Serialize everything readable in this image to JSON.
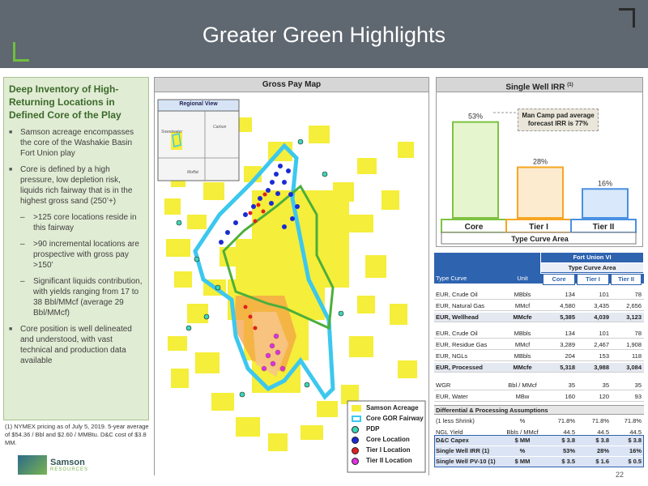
{
  "title": "Greater Green Highlights",
  "left_panel": {
    "heading": "Deep Inventory of High-Returning Locations in Defined Core of the Play",
    "bullets": [
      "Samson acreage encompasses the core of the Washakie Basin Fort Union play",
      "Core is defined by a high pressure, low depletion risk, liquids rich fairway that is in the highest gross sand (250’+)"
    ],
    "sub_bullets": [
      ">125 core locations reside in this fairway",
      ">90 incremental locations are prospective with gross pay >150’",
      "Significant liquids contribution, with yields ranging from 17 to 38 Bbl/MMcf (average 29 Bbl/MMcf)"
    ],
    "last_bullet": "Core position is well delineated and understood, with vast technical and production data available"
  },
  "footnote": "(1)  NYMEX pricing as of July 5, 2019. 5-year average of $54.36 / Bbl and $2.60 / MMBtu. D&C cost of $3.8 MM.",
  "logo": {
    "name": "Samson",
    "sub": "RESOURCES"
  },
  "map": {
    "title": "Gross Pay Map",
    "inset_title": "Regional View",
    "inset_labels": [
      "Sweetwater",
      "Carbon",
      "Moffat"
    ],
    "legend": [
      {
        "label": "Samson Acreage",
        "color": "#f5ee3a",
        "kind": "rect"
      },
      {
        "label": "Core GOR Fairway",
        "color": "#3cc8ee",
        "kind": "outline"
      },
      {
        "label": "PDP",
        "color": "#3ad6b6",
        "kind": "dot"
      },
      {
        "label": "Core Location",
        "color": "#1a2bd1",
        "kind": "dot"
      },
      {
        "label": "Tier I Location",
        "color": "#e02020",
        "kind": "dot"
      },
      {
        "label": "Tier II Location",
        "color": "#e030e0",
        "kind": "dot"
      }
    ]
  },
  "irr": {
    "title": "Single Well IRR",
    "title_sup": "(1)",
    "callout": "Man Camp pad average forecast IRR is 77%",
    "axis_label": "Type Curve Area"
  },
  "chart_data": {
    "type": "bar",
    "title": "Single Well IRR",
    "categories": [
      "Core",
      "Tier I",
      "Tier II"
    ],
    "values": [
      53,
      28,
      16
    ],
    "value_labels": [
      "53%",
      "28%",
      "16%"
    ],
    "xlabel": "Type Curve Area",
    "ylim": [
      0,
      60
    ],
    "colors": {
      "fill": [
        "#e5f5ce",
        "#fdebcf",
        "#d9e8fa"
      ],
      "stroke": [
        "#7ec242",
        "#f5a623",
        "#4a90e2"
      ]
    }
  },
  "table": {
    "play": "Fort Union VI",
    "group_label": "Type Curve Area",
    "headers": [
      "Type Curve",
      "Unit",
      "Core",
      "Tier I",
      "Tier II"
    ],
    "rows": [
      {
        "label": "EUR, Crude Oil",
        "unit": "MBbls",
        "core": "134",
        "t1": "101",
        "t2": "78"
      },
      {
        "label": "EUR, Natural Gas",
        "unit": "MMcf",
        "core": "4,580",
        "t1": "3,435",
        "t2": "2,656"
      },
      {
        "label": "EUR, Wellhead",
        "unit": "MMcfe",
        "core": "5,385",
        "t1": "4,039",
        "t2": "3,123",
        "bold": true
      },
      {
        "label": "EUR, Crude Oil",
        "unit": "MBbls",
        "core": "134",
        "t1": "101",
        "t2": "78"
      },
      {
        "label": "EUR, Residue Gas",
        "unit": "MMcf",
        "core": "3,289",
        "t1": "2,467",
        "t2": "1,908"
      },
      {
        "label": "EUR, NGLs",
        "unit": "MBbls",
        "core": "204",
        "t1": "153",
        "t2": "118"
      },
      {
        "label": "EUR, Processed",
        "unit": "MMcfe",
        "core": "5,318",
        "t1": "3,988",
        "t2": "3,084",
        "bold": true
      },
      {
        "label": "WGR",
        "unit": "Bbl / MMcf",
        "core": "35",
        "t1": "35",
        "t2": "35"
      },
      {
        "label": "EUR, Water",
        "unit": "MBw",
        "core": "160",
        "t1": "120",
        "t2": "93"
      }
    ],
    "diff_header": "Differential & Processing Assumptions",
    "diff_rows": [
      {
        "label": "(1 less Shrink)",
        "unit": "%",
        "core": "71.8%",
        "t1": "71.8%",
        "t2": "71.8%"
      },
      {
        "label": "NGL Yield",
        "unit": "Bbls / MMcf",
        "core": "44.5",
        "t1": "44.5",
        "t2": "44.5"
      }
    ],
    "summary_rows": [
      {
        "label": "D&C Capex",
        "unit": "$ MM",
        "core": "$     3.8",
        "t1": "$     3.8",
        "t2": "$     3.8"
      },
      {
        "label": "Single Well IRR (1)",
        "unit": "%",
        "core": "53%",
        "t1": "28%",
        "t2": "16%"
      },
      {
        "label": "Single Well PV-10 (1)",
        "unit": "$ MM",
        "core": "$     3.5",
        "t1": "$     1.6",
        "t2": "$     0.5"
      }
    ]
  },
  "page_number": "22"
}
